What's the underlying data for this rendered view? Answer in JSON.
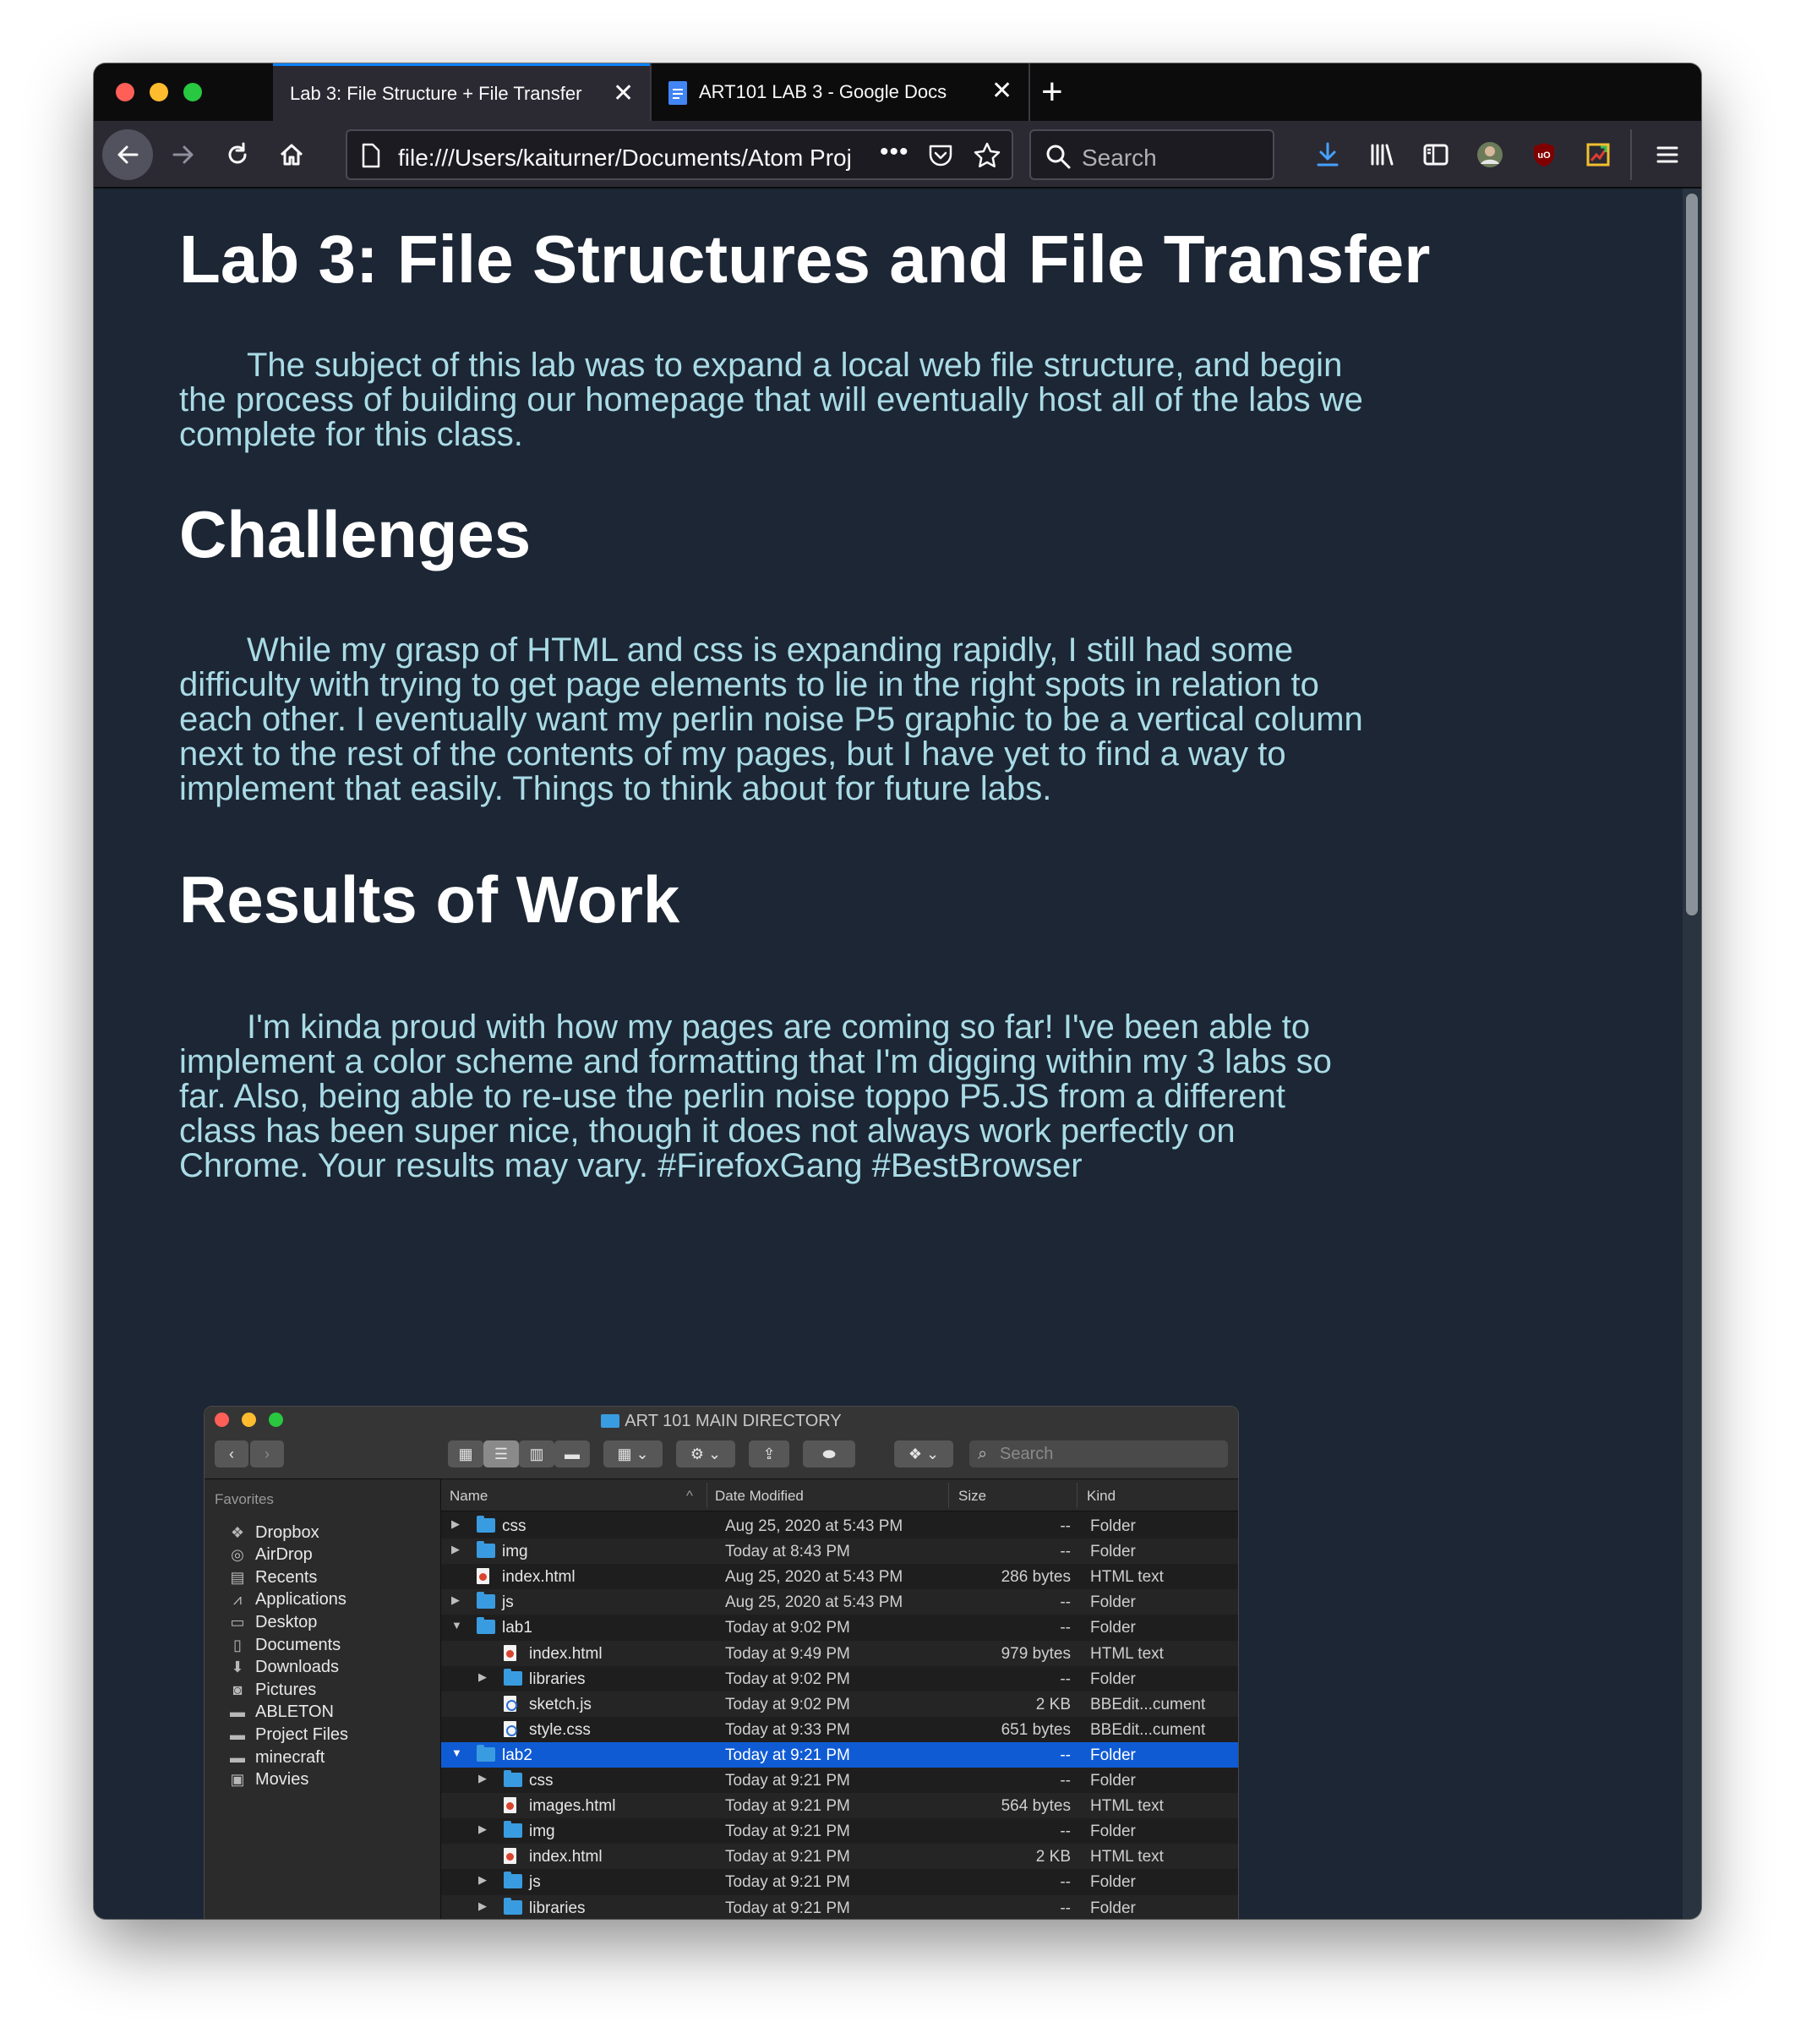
{
  "browser": {
    "tabs": [
      {
        "title": "Lab 3: File Structure + File Transfer",
        "active": true
      },
      {
        "title": "ART101 LAB 3 - Google Docs",
        "active": false
      }
    ],
    "url": "file:///Users/kaiturner/Documents/Atom Proj",
    "search_placeholder": "Search",
    "icons": [
      "back-icon",
      "forward-icon",
      "reload-icon",
      "home-icon",
      "page-icon",
      "more-icon",
      "pocket-icon",
      "bookmark-star-icon",
      "search-icon",
      "download-icon",
      "library-icon",
      "sidebar-icon",
      "account-avatar-icon",
      "ublock-icon",
      "extension-icon",
      "menu-icon"
    ],
    "accent_color": "#0a84ff"
  },
  "page": {
    "title": "Lab 3: File Structures and File Transfer",
    "intro": "The subject of this lab was to expand a local web file structure, and begin the process of building our homepage that will eventually host all of the labs we complete for this class.",
    "sections": [
      {
        "heading": "Challenges",
        "body": "While my grasp of HTML and css is expanding rapidly, I still had some difficulty with trying to get page elements to lie in the right spots in relation to each other. I eventually want my perlin noise P5 graphic to be a vertical column next to the rest of the contents of my pages, but I have yet to find a way to implement that easily. Things to think about for future labs."
      },
      {
        "heading": "Results of Work",
        "body": "I'm kinda proud with how my pages are coming so far! I've been able to implement a color scheme and formatting that I'm digging within my 3 labs so far. Also, being able to re-use the perlin noise toppo P5.JS from a different class has been super nice, though it does not always work perfectly on Chrome. Your results may vary. #FirefoxGang #BestBrowser"
      }
    ],
    "heading_color": "#ffffff",
    "text_color": "#a9dbe6",
    "background_color": "#1c2634"
  },
  "finder": {
    "title": "ART 101 MAIN DIRECTORY",
    "search_placeholder": "Search",
    "sidebar_heading": "Favorites",
    "sidebar_items": [
      {
        "label": "Dropbox",
        "icon": "dropbox-icon"
      },
      {
        "label": "AirDrop",
        "icon": "airdrop-icon"
      },
      {
        "label": "Recents",
        "icon": "recents-icon"
      },
      {
        "label": "Applications",
        "icon": "applications-icon"
      },
      {
        "label": "Desktop",
        "icon": "desktop-icon"
      },
      {
        "label": "Documents",
        "icon": "documents-icon"
      },
      {
        "label": "Downloads",
        "icon": "downloads-icon"
      },
      {
        "label": "Pictures",
        "icon": "pictures-icon"
      },
      {
        "label": "ABLETON",
        "icon": "folder-icon"
      },
      {
        "label": "Project Files",
        "icon": "folder-icon"
      },
      {
        "label": "minecraft",
        "icon": "folder-icon"
      },
      {
        "label": "Movies",
        "icon": "movies-icon"
      }
    ],
    "columns": {
      "name": "Name",
      "date": "Date Modified",
      "size": "Size",
      "kind": "Kind"
    },
    "rows": [
      {
        "name": "css",
        "date": "Aug 25, 2020 at 5:43 PM",
        "size": "--",
        "kind": "Folder",
        "type": "folder",
        "depth": 0,
        "disclosure": "collapsed"
      },
      {
        "name": "img",
        "date": "Today at 8:43 PM",
        "size": "--",
        "kind": "Folder",
        "type": "folder",
        "depth": 0,
        "disclosure": "collapsed"
      },
      {
        "name": "index.html",
        "date": "Aug 25, 2020 at 5:43 PM",
        "size": "286 bytes",
        "kind": "HTML text",
        "type": "html",
        "depth": 0,
        "disclosure": "none"
      },
      {
        "name": "js",
        "date": "Aug 25, 2020 at 5:43 PM",
        "size": "--",
        "kind": "Folder",
        "type": "folder",
        "depth": 0,
        "disclosure": "collapsed"
      },
      {
        "name": "lab1",
        "date": "Today at 9:02 PM",
        "size": "--",
        "kind": "Folder",
        "type": "folder",
        "depth": 0,
        "disclosure": "expanded"
      },
      {
        "name": "index.html",
        "date": "Today at 9:49 PM",
        "size": "979 bytes",
        "kind": "HTML text",
        "type": "html",
        "depth": 1,
        "disclosure": "none"
      },
      {
        "name": "libraries",
        "date": "Today at 9:02 PM",
        "size": "--",
        "kind": "Folder",
        "type": "folder",
        "depth": 1,
        "disclosure": "collapsed"
      },
      {
        "name": "sketch.js",
        "date": "Today at 9:02 PM",
        "size": "2 KB",
        "kind": "BBEdit...cument",
        "type": "code",
        "depth": 1,
        "disclosure": "none"
      },
      {
        "name": "style.css",
        "date": "Today at 9:33 PM",
        "size": "651 bytes",
        "kind": "BBEdit...cument",
        "type": "code",
        "depth": 1,
        "disclosure": "none"
      },
      {
        "name": "lab2",
        "date": "Today at 9:21 PM",
        "size": "--",
        "kind": "Folder",
        "type": "folder",
        "depth": 0,
        "disclosure": "expanded",
        "selected": true
      },
      {
        "name": "css",
        "date": "Today at 9:21 PM",
        "size": "--",
        "kind": "Folder",
        "type": "folder",
        "depth": 1,
        "disclosure": "collapsed"
      },
      {
        "name": "images.html",
        "date": "Today at 9:21 PM",
        "size": "564 bytes",
        "kind": "HTML text",
        "type": "html",
        "depth": 1,
        "disclosure": "none"
      },
      {
        "name": "img",
        "date": "Today at 9:21 PM",
        "size": "--",
        "kind": "Folder",
        "type": "folder",
        "depth": 1,
        "disclosure": "collapsed"
      },
      {
        "name": "index.html",
        "date": "Today at 9:21 PM",
        "size": "2 KB",
        "kind": "HTML text",
        "type": "html",
        "depth": 1,
        "disclosure": "none"
      },
      {
        "name": "js",
        "date": "Today at 9:21 PM",
        "size": "--",
        "kind": "Folder",
        "type": "folder",
        "depth": 1,
        "disclosure": "collapsed"
      },
      {
        "name": "libraries",
        "date": "Today at 9:21 PM",
        "size": "--",
        "kind": "Folder",
        "type": "folder",
        "depth": 1,
        "disclosure": "collapsed"
      }
    ],
    "selection_color": "#0f5bd4"
  }
}
